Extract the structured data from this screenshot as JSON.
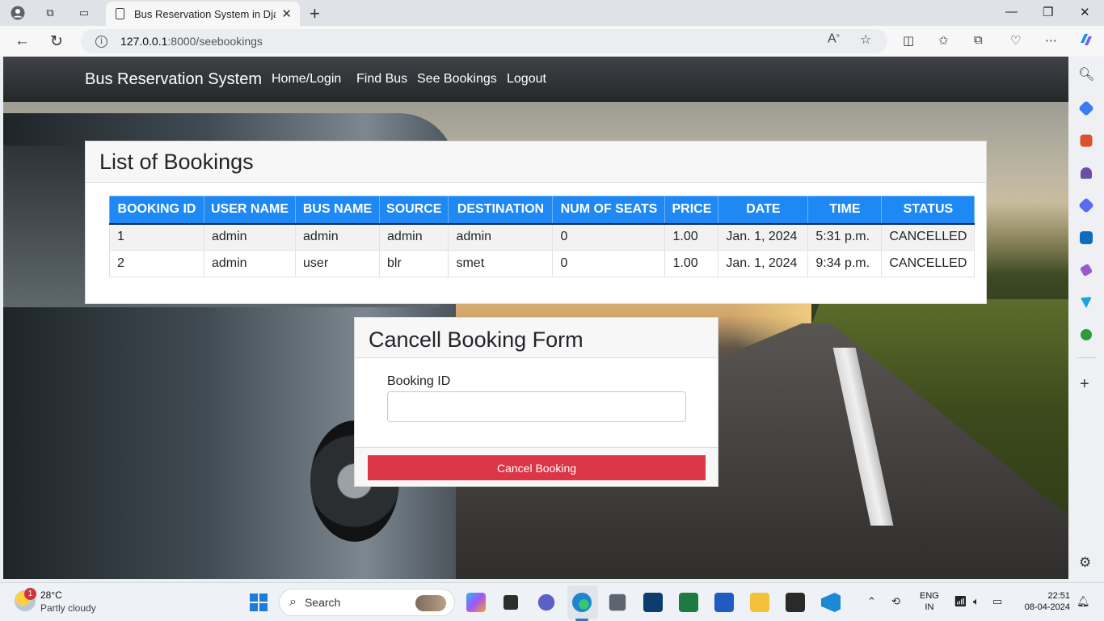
{
  "browser": {
    "tab_title": "Bus Reservation System in Django",
    "url_host": "127.0.0.1",
    "url_path": ":8000/seebookings"
  },
  "navbar": {
    "brand": "Bus Reservation System",
    "links": [
      "Home/Login",
      "Find Bus",
      "See Bookings",
      "Logout"
    ]
  },
  "bookings": {
    "title": "List of Bookings",
    "columns": [
      "BOOKING ID",
      "USER NAME",
      "BUS NAME",
      "SOURCE",
      "DESTINATION",
      "NUM OF SEATS",
      "PRICE",
      "DATE",
      "TIME",
      "STATUS"
    ],
    "rows": [
      [
        "1",
        "admin",
        "admin",
        "admin",
        "admin",
        "0",
        "1.00",
        "Jan. 1, 2024",
        "5:31 p.m.",
        "CANCELLED"
      ],
      [
        "2",
        "admin",
        "user",
        "blr",
        "smet",
        "0",
        "1.00",
        "Jan. 1, 2024",
        "9:34 p.m.",
        "CANCELLED"
      ]
    ]
  },
  "cancel_form": {
    "title": "Cancell Booking Form",
    "field_label": "Booking ID",
    "field_value": "",
    "button_label": "Cancel Booking"
  },
  "taskbar": {
    "weather_badge": "1",
    "weather_temp": "28°C",
    "weather_desc": "Partly cloudy",
    "search_placeholder": "Search",
    "lang_top": "ENG",
    "lang_bottom": "IN",
    "time": "22:51",
    "date": "08-04-2024"
  },
  "colors": {
    "table_header": "#1e88f5",
    "danger_button": "#dc3545",
    "navbar": "#25282b"
  }
}
